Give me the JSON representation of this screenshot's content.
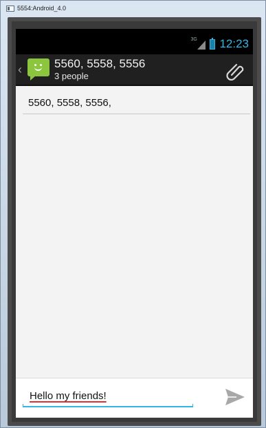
{
  "window": {
    "title": "5554:Android_4.0"
  },
  "statusbar": {
    "network_label": "3G",
    "time": "12:23",
    "accent": "#33b5e5"
  },
  "actionbar": {
    "title": "5560, 5558, 5556",
    "subtitle": "3 people",
    "app_icon": "messaging-app-icon",
    "attach_icon": "paperclip-icon"
  },
  "recipients": {
    "value": "5560, 5558, 5556,"
  },
  "compose": {
    "value": "Hello my friends!",
    "send_icon": "send-icon"
  },
  "colors": {
    "app_icon": "#8cc63e",
    "actionbar": "#202020",
    "content_bg": "#f3f3f3"
  }
}
